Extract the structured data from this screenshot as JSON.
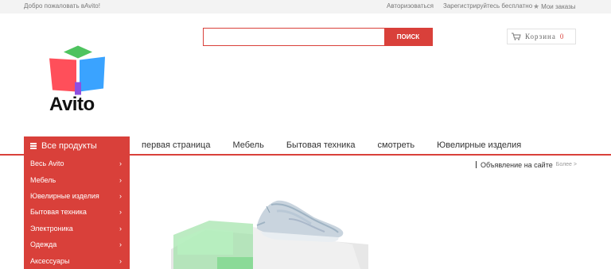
{
  "topbar": {
    "welcome": "Добро пожаловать вAvito!",
    "login": "Авторизоваться",
    "register": "Зарегистрируйтесь бесплатно",
    "orders": "Мои заказы"
  },
  "logo": {
    "text": "Avito",
    "colors": {
      "green": "#4ec35f",
      "red": "#ff4f5a",
      "blue": "#3aa3ff",
      "purple": "#8d50e0"
    }
  },
  "search": {
    "value": "",
    "placeholder": "",
    "button": "ПОИСК"
  },
  "cart": {
    "label": "Корзина",
    "count": "0"
  },
  "allproducts": {
    "label": "Все продукты"
  },
  "nav": [
    "первая страница",
    "Мебель",
    "Бытовая техника",
    "смотреть",
    "Ювелирные изделия"
  ],
  "sidemenu": [
    {
      "label": "Весь Avito"
    },
    {
      "label": "Мебель"
    },
    {
      "label": "Ювелирные изделия"
    },
    {
      "label": "Бытовая техника"
    },
    {
      "label": "Электроника"
    },
    {
      "label": "Одежда"
    },
    {
      "label": "Аксессуары"
    }
  ],
  "ads": {
    "title": "Объявление на сайте",
    "more": "Более >"
  },
  "colors": {
    "accent": "#d9403a",
    "topbar_bg": "#f3f3f3"
  }
}
